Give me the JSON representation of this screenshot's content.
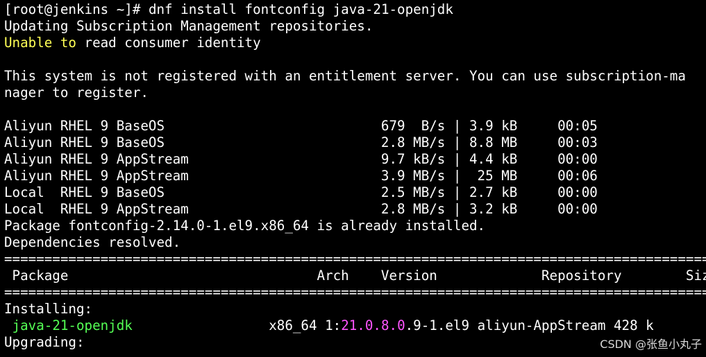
{
  "terminal": {
    "prompt": "[root@jenkins ~]# ",
    "command": "dnf install fontconfig java-21-openjdk",
    "line_subscription": "Updating Subscription Management repositories.",
    "unable_word": "Unable to",
    "unable_rest": " read consumer identity",
    "registration_line_1": "This system is not registered with an entitlement server. You can use subscription-ma",
    "registration_line_2": "nager to register.",
    "repo_lines": [
      "Aliyun RHEL 9 BaseOS                           679  B/s | 3.9 kB     00:05",
      "Aliyun RHEL 9 BaseOS                           2.8 MB/s | 8.8 MB     00:03",
      "Aliyun RHEL 9 AppStream                        9.7 kB/s | 4.4 kB     00:00",
      "Aliyun RHEL 9 AppStream                        3.9 MB/s |  25 MB     00:06",
      "Local  RHEL 9 BaseOS                           2.5 MB/s | 2.7 kB     00:00",
      "Local  RHEL 9 AppStream                        2.8 MB/s | 3.2 kB     00:00"
    ],
    "package_installed": "Package fontconfig-2.14.0-1.el9.x86_64 is already installed.",
    "deps_resolved": "Dependencies resolved.",
    "separator": "==========================================================================================",
    "header_row": " Package                               Arch    Version             Repository        Size",
    "installing_label": "Installing:",
    "install_pkg_indent": " ",
    "install_pkg_name": "java-21-openjdk",
    "install_pkg_gap": "                 x86_64 1:",
    "install_version_highlight": "21.0.8.0",
    "install_version_rest": ".9-1.el9 aliyun-AppStream 428 k",
    "upgrading_label": "Upgrading:"
  },
  "colors": {
    "background": "#000000",
    "foreground": "#ffffff",
    "warning": "#ffff55",
    "package_name": "#55ff55",
    "version_highlight": "#ff55ff"
  },
  "watermark": {
    "text": "CSDN @张鱼小丸子"
  }
}
